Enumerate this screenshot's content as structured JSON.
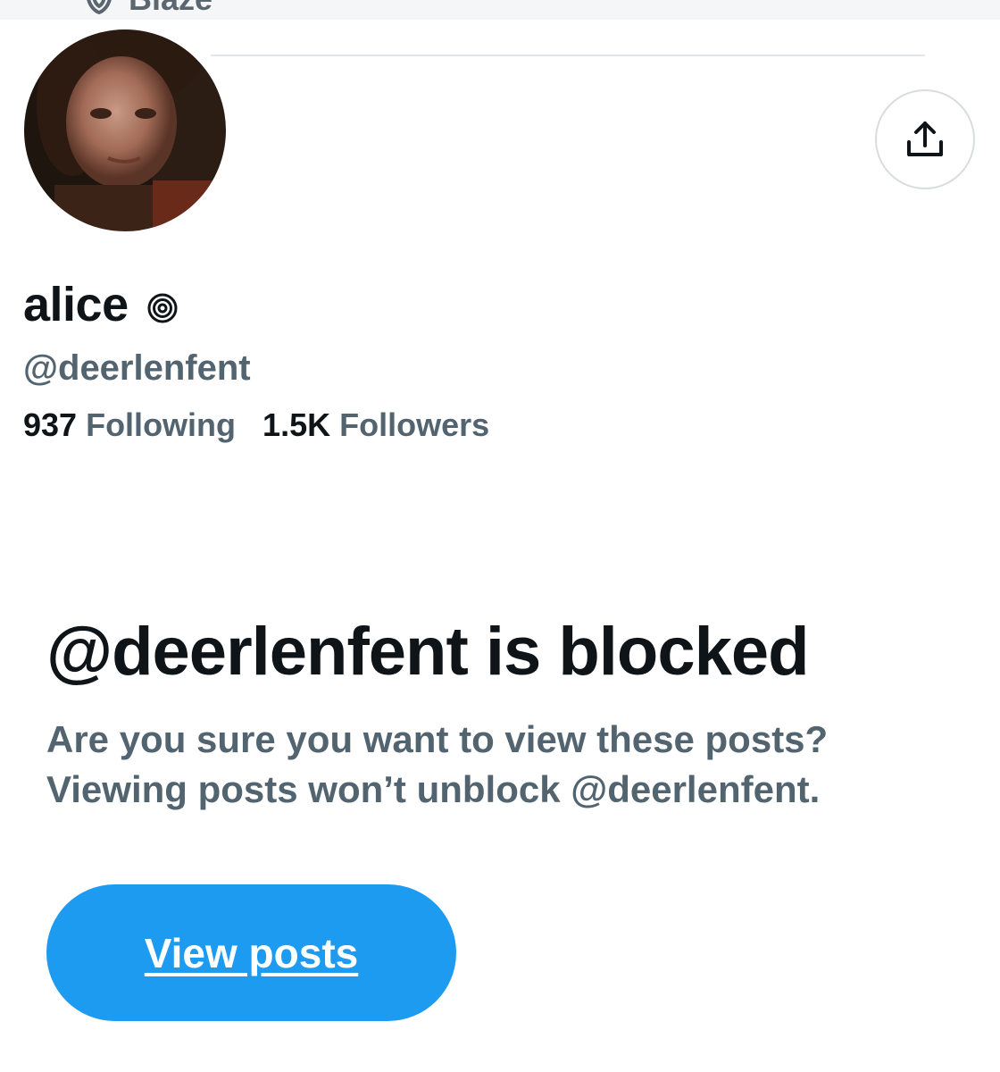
{
  "banner": {
    "label": "Blaze"
  },
  "profile": {
    "display_name": "alice",
    "name_icon": "spiral-icon",
    "handle": "@deerlenfent",
    "following_count": "937",
    "following_label": "Following",
    "followers_count": "1.5K",
    "followers_label": "Followers"
  },
  "share_button": {
    "icon": "share-upload-icon"
  },
  "blocked_notice": {
    "title": "@deerlenfent is blocked",
    "line1": "Are you sure you want to view these posts?",
    "line2": "Viewing posts won’t unblock @deerlenfent."
  },
  "view_posts_button": {
    "label": "View posts"
  },
  "colors": {
    "accent": "#1d9bf0",
    "text_primary": "#0f1419",
    "text_secondary": "#536471"
  }
}
